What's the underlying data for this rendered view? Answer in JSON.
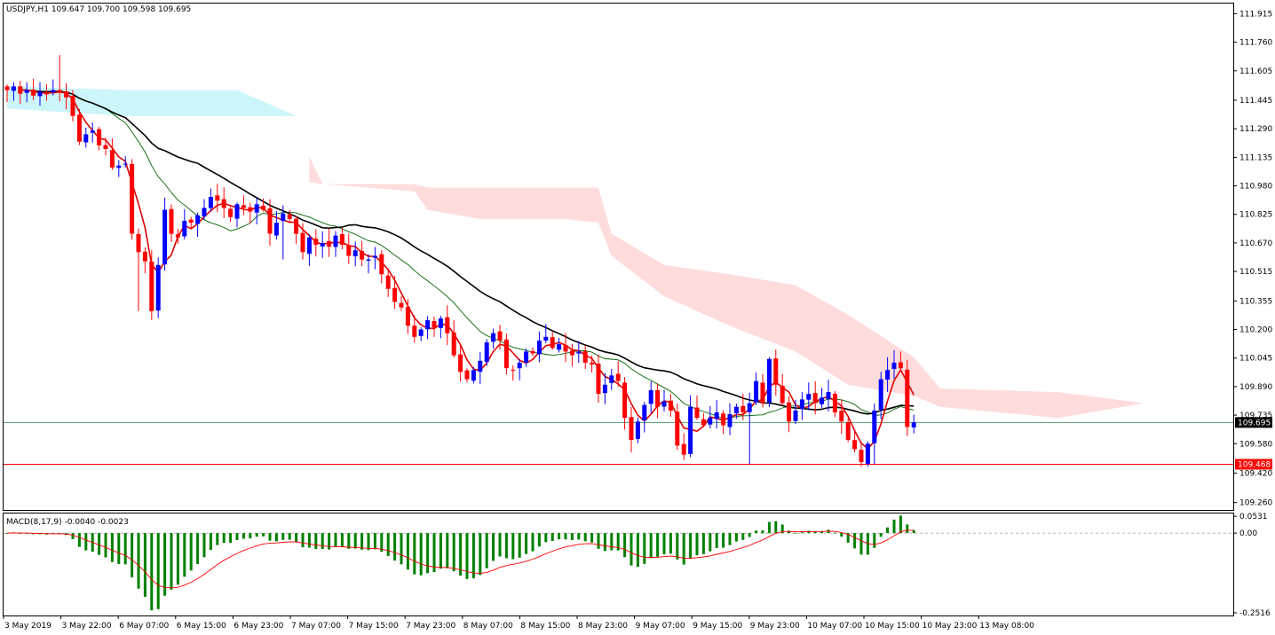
{
  "chart_data": {
    "type": "candlestick",
    "symbol_line": "USDJPY,H1  109.647 109.700 109.598 109.695",
    "price_ticks": [
      "111.915",
      "111.760",
      "111.605",
      "111.445",
      "111.290",
      "111.135",
      "110.980",
      "110.825",
      "110.670",
      "110.515",
      "110.355",
      "110.200",
      "110.045",
      "109.890",
      "109.735",
      "109.580",
      "109.420",
      "109.260"
    ],
    "ylim": [
      109.22,
      111.97
    ],
    "current_price": "109.695",
    "current_price_value": 109.695,
    "alert_price": "109.468",
    "alert_price_value": 109.468,
    "time_labels": [
      "3 May 2019",
      "3 May 22:00",
      "6 May 07:00",
      "6 May 15:00",
      "6 May 23:00",
      "7 May 07:00",
      "7 May 15:00",
      "7 May 23:00",
      "8 May 07:00",
      "8 May 15:00",
      "8 May 23:00",
      "9 May 07:00",
      "9 May 15:00",
      "9 May 23:00",
      "10 May 07:00",
      "10 May 15:00",
      "10 May 23:00",
      "13 May 08:00"
    ],
    "closes": [
      111.5,
      111.52,
      111.48,
      111.5,
      111.47,
      111.49,
      111.48,
      111.5,
      111.49,
      111.46,
      111.36,
      111.22,
      111.26,
      111.28,
      111.2,
      111.18,
      111.08,
      111.09,
      111.1,
      110.72,
      110.62,
      110.57,
      110.3,
      110.55,
      110.85,
      110.72,
      110.7,
      110.79,
      110.78,
      110.82,
      110.86,
      110.92,
      110.9,
      110.86,
      110.81,
      110.88,
      110.86,
      110.84,
      110.88,
      110.85,
      110.72,
      110.78,
      110.83,
      110.8,
      110.72,
      110.62,
      110.7,
      110.66,
      110.67,
      110.65,
      110.71,
      110.66,
      110.6,
      110.63,
      110.58,
      110.58,
      110.6,
      110.5,
      110.42,
      110.35,
      110.32,
      110.22,
      110.16,
      110.2,
      110.25,
      110.21,
      110.26,
      110.18,
      110.06,
      109.97,
      109.93,
      109.98,
      110.03,
      110.13,
      110.18,
      110.14,
      109.99,
      109.98,
      110.02,
      110.08,
      110.07,
      110.14,
      110.16,
      110.1,
      110.12,
      110.08,
      110.06,
      110.08,
      110.02,
      110.01,
      109.85,
      109.9,
      109.95,
      109.92,
      109.72,
      109.6,
      109.7,
      109.79,
      109.87,
      109.78,
      109.81,
      109.76,
      109.57,
      109.52,
      109.78,
      109.72,
      109.68,
      109.72,
      109.75,
      109.68,
      109.74,
      109.78,
      109.75,
      109.8,
      109.92,
      109.8,
      110.04,
      109.9,
      109.8,
      109.7,
      109.76,
      109.82,
      109.85,
      109.8,
      109.83,
      109.86,
      109.75,
      109.7,
      109.6,
      109.55,
      109.48,
      109.58,
      109.76,
      109.93,
      109.98,
      110.02,
      109.99,
      109.67,
      109.695
    ],
    "series": [
      {
        "name": "MA fast",
        "color": "#e00000"
      },
      {
        "name": "MA mid",
        "color": "#006400"
      },
      {
        "name": "MA slow",
        "color": "#000000"
      },
      {
        "name": "Ichimoku cloud",
        "color": "#ffdcdc"
      }
    ],
    "colors": {
      "bull": "#0000ff",
      "bear": "#ff0000",
      "cloud_up": "#ccf6fa",
      "cloud_down": "#ffdcdc",
      "hline_current": "#2e8b57",
      "hline_alert": "#ff0000"
    },
    "macd": {
      "label": "MACD(8,17,9) -0.0040 -0.0023",
      "ticks": [
        "0.0531",
        "0.00",
        "-0.2516"
      ],
      "ylim": [
        -0.26,
        0.062
      ],
      "hist_color": "#008000",
      "signal_color": "#ff0000"
    }
  }
}
